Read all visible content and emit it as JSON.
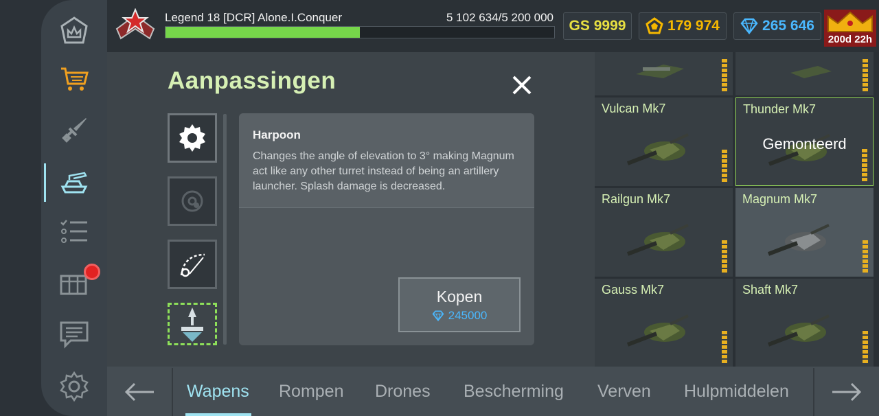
{
  "player": {
    "name": "Legend 18  [DCR] Alone.I.Conquer",
    "experience_text": "5 102 634/5 200 000",
    "experience_progress": 0.5
  },
  "currencies": {
    "gs": "GS 9999",
    "crystals": "179 974",
    "diamonds": "265 646"
  },
  "premium": {
    "time_left": "200d 22h"
  },
  "sidebar": {
    "items": [
      {
        "icon": "home-crown-icon"
      },
      {
        "icon": "shop-cart-icon"
      },
      {
        "icon": "battle-sword-icon"
      },
      {
        "icon": "garage-tank-icon",
        "active": true
      },
      {
        "icon": "missions-list-icon"
      },
      {
        "icon": "containers-chest-icon",
        "notification": true
      },
      {
        "icon": "chat-icon"
      },
      {
        "icon": "settings-gear-icon"
      }
    ]
  },
  "dialog": {
    "title": "Aanpassingen",
    "alteration": {
      "name": "Harpoon",
      "description": "Changes the angle of elevation to 3° making Magnum act like any other turret instead of being an artillery launcher. Splash damage is decreased."
    },
    "buy_button": {
      "label": "Kopen",
      "price": "245000"
    }
  },
  "turrets": [
    {
      "name": "Vulcan Mk7",
      "selected": false,
      "mounted": false
    },
    {
      "name": "Thunder Mk7",
      "selected": false,
      "mounted": true
    },
    {
      "name": "Railgun Mk7",
      "selected": false,
      "mounted": false
    },
    {
      "name": "Magnum Mk7",
      "selected": true,
      "mounted": false
    },
    {
      "name": "Gauss Mk7",
      "selected": false,
      "mounted": false
    },
    {
      "name": "Shaft Mk7",
      "selected": false,
      "mounted": false
    }
  ],
  "mounted_label": "Gemonteerd",
  "tabs": [
    "Wapens",
    "Rompen",
    "Drones",
    "Bescherming",
    "Verven",
    "Hulpmiddelen"
  ],
  "colors": {
    "accent": "#9fe2f0",
    "title_green": "#d6f0b4",
    "exp_green": "#76d64a",
    "gs_yellow": "#e8e042",
    "crystal_gold": "#f5b800",
    "diamond_blue": "#4ab8ff",
    "notification_red": "#e22222"
  }
}
